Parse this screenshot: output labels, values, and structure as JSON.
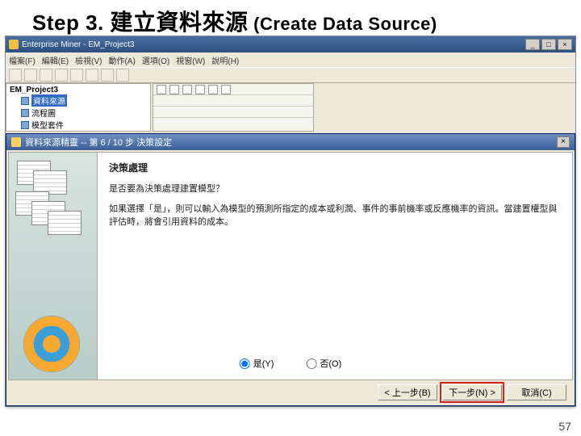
{
  "slide": {
    "step_prefix": "Step 3. ",
    "title_zh": "建立資料來源",
    "title_en": " (Create Data Source)",
    "page_number": "57"
  },
  "main_window": {
    "title": "Enterprise Miner - EM_Project3",
    "menu": {
      "file": "檔案(F)",
      "edit": "編輯(E)",
      "view": "檢視(V)",
      "actions": "動作(A)",
      "options": "選項(O)",
      "window": "視窗(W)",
      "help": "說明(H)"
    }
  },
  "tree": {
    "root": "EM_Project3",
    "items": [
      {
        "label": "資料來源",
        "selected": true
      },
      {
        "label": "流程圖",
        "selected": false
      },
      {
        "label": "模型套件",
        "selected": false
      }
    ]
  },
  "wizard": {
    "title": "資料來源精靈 -- 第 6 / 10 步 決策設定",
    "heading": "決策處理",
    "question": "是否要為決策處理建置模型？",
    "explain": "如果選擇「是」，則可以輸入為模型的預測所指定的成本或利潤、事件的事前機率或反應機率的資訊。當建置權型與評估時，將會引用資料的成本。",
    "radio": {
      "yes": "是(Y)",
      "no": "否(O)",
      "selected": "yes"
    },
    "buttons": {
      "back": "< 上一步(B)",
      "next": "下一步(N) >",
      "cancel": "取消(C)"
    }
  }
}
